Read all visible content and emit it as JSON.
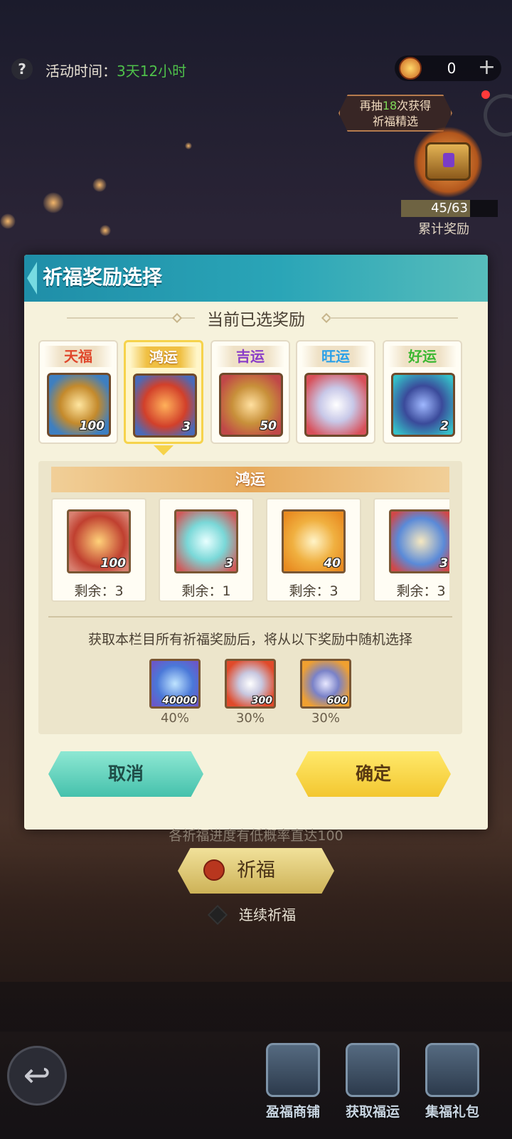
{
  "header": {
    "help_label": "?",
    "activity_label": "活动时间：",
    "activity_value": "3天12小时",
    "currency_value": "0",
    "currency_plus": "+"
  },
  "milestone": {
    "tip_prefix": "再抽",
    "tip_count": "18",
    "tip_suffix": "次获得",
    "tip_line2": "祈福精选",
    "progress_text": "45/63",
    "progress_fraction": 0.714,
    "label": "累计奖励"
  },
  "modal": {
    "title": "祈福奖励选择",
    "subtitle": "当前已选奖励",
    "tabs": [
      {
        "label": "天福",
        "count": "100",
        "color": "#e0482c",
        "icon": "gold-chest-icon"
      },
      {
        "label": "鸿运",
        "count": "3",
        "color": "#ffffff",
        "icon": "flame-icon"
      },
      {
        "label": "吉运",
        "count": "50",
        "color": "#8a3cc8",
        "icon": "gold-chest-icon"
      },
      {
        "label": "旺运",
        "count": "",
        "color": "#2aa0e8",
        "icon": "crystal-box-icon"
      },
      {
        "label": "好运",
        "count": "2",
        "color": "#3cb832",
        "icon": "rune-gem-icon"
      }
    ],
    "selected_tab": "鸿运",
    "panel_title": "鸿运",
    "rewards": [
      {
        "count": "100",
        "remaining": "剩余：3",
        "icon": "golden-armor-icon"
      },
      {
        "count": "3",
        "remaining": "剩余：1",
        "icon": "blade-icon"
      },
      {
        "count": "40",
        "remaining": "剩余：3",
        "icon": "gyroscope-pedestal-icon"
      },
      {
        "count": "3",
        "remaining": "剩余：3",
        "icon": "orb-icon"
      }
    ],
    "note": "获取本栏目所有祈福奖励后，将从以下奖励中随机选择",
    "random_rewards": [
      {
        "count": "40000",
        "percent": "40%",
        "icon": "blue-crystal-icon"
      },
      {
        "count": "300",
        "percent": "30%",
        "icon": "star-shard-icon"
      },
      {
        "count": "600",
        "percent": "30%",
        "icon": "spear-shard-icon"
      }
    ],
    "cancel_label": "取消",
    "confirm_label": "确定"
  },
  "footer": {
    "hint": "各祈福进度有低概率直达100",
    "pray_label": "祈福",
    "continuous_label": "连续祈福",
    "back_icon": "↩",
    "nav": [
      {
        "label": "盈福商铺",
        "icon": "shop-icon"
      },
      {
        "label": "获取福运",
        "icon": "book-icon"
      },
      {
        "label": "集福礼包",
        "icon": "gift-icon"
      }
    ]
  },
  "colors": {
    "accent_teal": "#2aa5b7",
    "accent_gold": "#f3c730",
    "activity_green": "#4ec04a"
  }
}
